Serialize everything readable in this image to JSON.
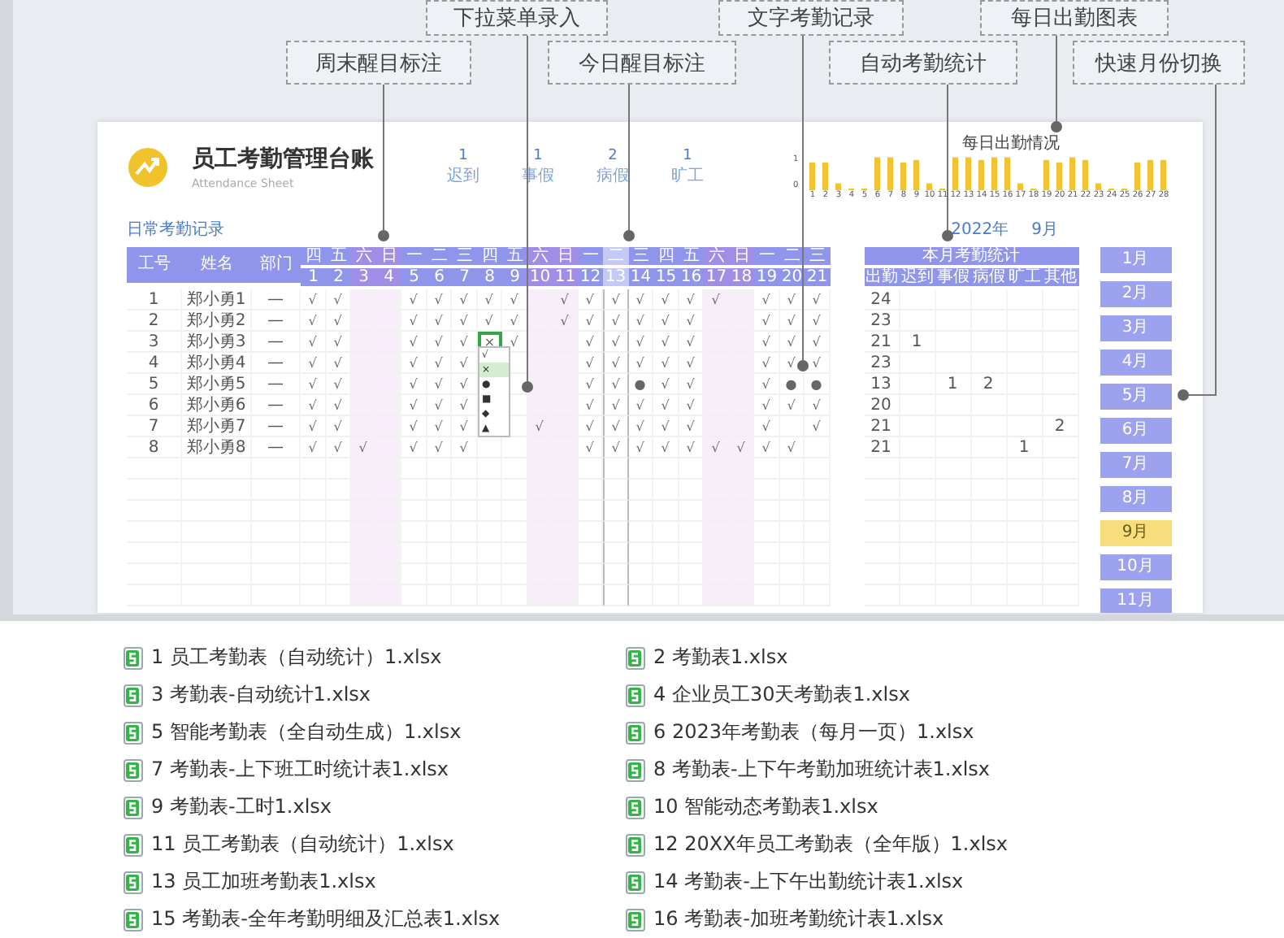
{
  "callouts": [
    {
      "label": "下拉菜单录入"
    },
    {
      "label": "文字考勤记录"
    },
    {
      "label": "每日出勤图表"
    },
    {
      "label": "周末醒目标注"
    },
    {
      "label": "今日醒目标注"
    },
    {
      "label": "自动考勤统计"
    },
    {
      "label": "快速月份切换"
    }
  ],
  "sheet": {
    "title": "员工考勤管理台账",
    "subtitle": "Attendance Sheet",
    "summary": [
      {
        "value": "1",
        "label": "迟到"
      },
      {
        "value": "1",
        "label": "事假"
      },
      {
        "value": "2",
        "label": "病假"
      },
      {
        "value": "1",
        "label": "旷工"
      }
    ],
    "chart": {
      "title": "每日出勤情况",
      "y_labels": [
        "1",
        "0"
      ],
      "days": [
        "1",
        "2",
        "3",
        "4",
        "5",
        "6",
        "7",
        "8",
        "9",
        "10",
        "11",
        "12",
        "13",
        "14",
        "15",
        "16",
        "17",
        "18",
        "19",
        "20",
        "21",
        "22",
        "23",
        "24",
        "25",
        "26",
        "27",
        "28"
      ]
    },
    "section_title": "日常考勤记录",
    "year": "2022年",
    "month": "9月",
    "columns": [
      "工号",
      "姓名",
      "部门"
    ],
    "days": [
      {
        "weekday": "四",
        "date": "1",
        "weekend": false,
        "today": false
      },
      {
        "weekday": "五",
        "date": "2",
        "weekend": false,
        "today": false
      },
      {
        "weekday": "六",
        "date": "3",
        "weekend": true,
        "today": false
      },
      {
        "weekday": "日",
        "date": "4",
        "weekend": true,
        "today": false
      },
      {
        "weekday": "一",
        "date": "5",
        "weekend": false,
        "today": false
      },
      {
        "weekday": "二",
        "date": "6",
        "weekend": false,
        "today": false
      },
      {
        "weekday": "三",
        "date": "7",
        "weekend": false,
        "today": false
      },
      {
        "weekday": "四",
        "date": "8",
        "weekend": false,
        "today": false
      },
      {
        "weekday": "五",
        "date": "9",
        "weekend": false,
        "today": false
      },
      {
        "weekday": "六",
        "date": "10",
        "weekend": true,
        "today": false
      },
      {
        "weekday": "日",
        "date": "11",
        "weekend": true,
        "today": false
      },
      {
        "weekday": "一",
        "date": "12",
        "weekend": false,
        "today": false
      },
      {
        "weekday": "二",
        "date": "13",
        "weekend": false,
        "today": true
      },
      {
        "weekday": "三",
        "date": "14",
        "weekend": false,
        "today": false
      },
      {
        "weekday": "四",
        "date": "15",
        "weekend": false,
        "today": false
      },
      {
        "weekday": "五",
        "date": "16",
        "weekend": false,
        "today": false
      },
      {
        "weekday": "六",
        "date": "17",
        "weekend": true,
        "today": false
      },
      {
        "weekday": "日",
        "date": "18",
        "weekend": true,
        "today": false
      },
      {
        "weekday": "一",
        "date": "19",
        "weekend": false,
        "today": false
      },
      {
        "weekday": "二",
        "date": "20",
        "weekend": false,
        "today": false
      },
      {
        "weekday": "三",
        "date": "21",
        "weekend": false,
        "today": false
      }
    ],
    "stats_title": "本月考勤统计",
    "stats_columns": [
      "出勤",
      "迟到",
      "事假",
      "病假",
      "旷工",
      "其他"
    ],
    "rows": [
      {
        "id": "1",
        "name": "郑小勇1",
        "dept": "—",
        "editing": false,
        "marks": [
          {
            "kind": "mark",
            "text": "√"
          },
          {
            "kind": "mark",
            "text": "√"
          },
          {
            "kind": "empty"
          },
          {
            "kind": "empty"
          },
          {
            "kind": "mark",
            "text": "√"
          },
          {
            "kind": "mark",
            "text": "√"
          },
          {
            "kind": "mark",
            "text": "√"
          },
          {
            "kind": "mark",
            "text": "√"
          },
          {
            "kind": "mark",
            "text": "√"
          },
          {
            "kind": "empty"
          },
          {
            "kind": "mark",
            "text": "√"
          },
          {
            "kind": "mark",
            "text": "√"
          },
          {
            "kind": "mark",
            "text": "√"
          },
          {
            "kind": "mark",
            "text": "√"
          },
          {
            "kind": "mark",
            "text": "√"
          },
          {
            "kind": "mark",
            "text": "√"
          },
          {
            "kind": "mark",
            "text": "√"
          },
          {
            "kind": "empty"
          },
          {
            "kind": "mark",
            "text": "√"
          },
          {
            "kind": "mark",
            "text": "√"
          },
          {
            "kind": "mark",
            "text": "√"
          }
        ],
        "stats": [
          {
            "kind": "value",
            "text": "24"
          },
          {
            "kind": "empty"
          },
          {
            "kind": "empty"
          },
          {
            "kind": "empty"
          },
          {
            "kind": "empty"
          },
          {
            "kind": "empty"
          }
        ]
      },
      {
        "id": "2",
        "name": "郑小勇2",
        "dept": "—",
        "editing": false,
        "marks": [
          {
            "kind": "mark",
            "text": "√"
          },
          {
            "kind": "mark",
            "text": "√"
          },
          {
            "kind": "empty"
          },
          {
            "kind": "empty"
          },
          {
            "kind": "mark",
            "text": "√"
          },
          {
            "kind": "mark",
            "text": "√"
          },
          {
            "kind": "mark",
            "text": "√"
          },
          {
            "kind": "mark",
            "text": "√"
          },
          {
            "kind": "mark",
            "text": "√"
          },
          {
            "kind": "empty"
          },
          {
            "kind": "mark",
            "text": "√"
          },
          {
            "kind": "mark",
            "text": "√"
          },
          {
            "kind": "mark",
            "text": "√"
          },
          {
            "kind": "mark",
            "text": "√"
          },
          {
            "kind": "mark",
            "text": "√"
          },
          {
            "kind": "mark",
            "text": "√"
          },
          {
            "kind": "empty"
          },
          {
            "kind": "empty"
          },
          {
            "kind": "mark",
            "text": "√"
          },
          {
            "kind": "mark",
            "text": "√"
          },
          {
            "kind": "mark",
            "text": "√"
          }
        ],
        "stats": [
          {
            "kind": "value",
            "text": "23"
          },
          {
            "kind": "empty"
          },
          {
            "kind": "empty"
          },
          {
            "kind": "empty"
          },
          {
            "kind": "empty"
          },
          {
            "kind": "empty"
          }
        ]
      },
      {
        "id": "3",
        "name": "郑小勇3",
        "dept": "—",
        "editing": true,
        "marks": [
          {
            "kind": "mark",
            "text": "√"
          },
          {
            "kind": "mark",
            "text": "√"
          },
          {
            "kind": "empty"
          },
          {
            "kind": "empty"
          },
          {
            "kind": "mark",
            "text": "√"
          },
          {
            "kind": "mark",
            "text": "√"
          },
          {
            "kind": "mark",
            "text": "√"
          },
          {
            "kind": "mark",
            "text": "×"
          },
          {
            "kind": "mark",
            "text": "√"
          },
          {
            "kind": "empty"
          },
          {
            "kind": "empty"
          },
          {
            "kind": "mark",
            "text": "√"
          },
          {
            "kind": "mark",
            "text": "√"
          },
          {
            "kind": "mark",
            "text": "√"
          },
          {
            "kind": "mark",
            "text": "√"
          },
          {
            "kind": "mark",
            "text": "√"
          },
          {
            "kind": "empty"
          },
          {
            "kind": "empty"
          },
          {
            "kind": "mark",
            "text": "√"
          },
          {
            "kind": "mark",
            "text": "√"
          },
          {
            "kind": "mark",
            "text": "√"
          }
        ],
        "stats": [
          {
            "kind": "value",
            "text": "21"
          },
          {
            "kind": "value",
            "text": "1"
          },
          {
            "kind": "empty"
          },
          {
            "kind": "empty"
          },
          {
            "kind": "empty"
          },
          {
            "kind": "empty"
          }
        ]
      },
      {
        "id": "4",
        "name": "郑小勇4",
        "dept": "—",
        "editing": false,
        "marks": [
          {
            "kind": "mark",
            "text": "√"
          },
          {
            "kind": "mark",
            "text": "√"
          },
          {
            "kind": "empty"
          },
          {
            "kind": "empty"
          },
          {
            "kind": "mark",
            "text": "√"
          },
          {
            "kind": "mark",
            "text": "√"
          },
          {
            "kind": "mark",
            "text": "√"
          },
          {
            "kind": "empty"
          },
          {
            "kind": "empty"
          },
          {
            "kind": "empty"
          },
          {
            "kind": "empty"
          },
          {
            "kind": "mark",
            "text": "√"
          },
          {
            "kind": "mark",
            "text": "√"
          },
          {
            "kind": "mark",
            "text": "√"
          },
          {
            "kind": "mark",
            "text": "√"
          },
          {
            "kind": "mark",
            "text": "√"
          },
          {
            "kind": "empty"
          },
          {
            "kind": "empty"
          },
          {
            "kind": "mark",
            "text": "√"
          },
          {
            "kind": "mark",
            "text": "√"
          },
          {
            "kind": "mark",
            "text": "√"
          }
        ],
        "stats": [
          {
            "kind": "value",
            "text": "23"
          },
          {
            "kind": "empty"
          },
          {
            "kind": "empty"
          },
          {
            "kind": "empty"
          },
          {
            "kind": "empty"
          },
          {
            "kind": "empty"
          }
        ]
      },
      {
        "id": "5",
        "name": "郑小勇5",
        "dept": "—",
        "editing": false,
        "marks": [
          {
            "kind": "mark",
            "text": "√"
          },
          {
            "kind": "mark",
            "text": "√"
          },
          {
            "kind": "empty"
          },
          {
            "kind": "empty"
          },
          {
            "kind": "mark",
            "text": "√"
          },
          {
            "kind": "mark",
            "text": "√"
          },
          {
            "kind": "mark",
            "text": "√"
          },
          {
            "kind": "empty"
          },
          {
            "kind": "empty"
          },
          {
            "kind": "empty"
          },
          {
            "kind": "empty"
          },
          {
            "kind": "mark",
            "text": "√"
          },
          {
            "kind": "mark",
            "text": "√"
          },
          {
            "kind": "mark",
            "text": "●"
          },
          {
            "kind": "mark",
            "text": "√"
          },
          {
            "kind": "mark",
            "text": "√"
          },
          {
            "kind": "empty"
          },
          {
            "kind": "empty"
          },
          {
            "kind": "mark",
            "text": "√"
          },
          {
            "kind": "mark",
            "text": "●"
          },
          {
            "kind": "mark",
            "text": "●"
          }
        ],
        "stats": [
          {
            "kind": "value",
            "text": "13"
          },
          {
            "kind": "empty"
          },
          {
            "kind": "value",
            "text": "1"
          },
          {
            "kind": "value",
            "text": "2"
          },
          {
            "kind": "empty"
          },
          {
            "kind": "empty"
          }
        ]
      },
      {
        "id": "6",
        "name": "郑小勇6",
        "dept": "—",
        "editing": false,
        "marks": [
          {
            "kind": "mark",
            "text": "√"
          },
          {
            "kind": "mark",
            "text": "√"
          },
          {
            "kind": "empty"
          },
          {
            "kind": "empty"
          },
          {
            "kind": "mark",
            "text": "√"
          },
          {
            "kind": "mark",
            "text": "√"
          },
          {
            "kind": "mark",
            "text": "√"
          },
          {
            "kind": "empty"
          },
          {
            "kind": "empty"
          },
          {
            "kind": "empty"
          },
          {
            "kind": "empty"
          },
          {
            "kind": "mark",
            "text": "√"
          },
          {
            "kind": "mark",
            "text": "√"
          },
          {
            "kind": "mark",
            "text": "√"
          },
          {
            "kind": "mark",
            "text": "√"
          },
          {
            "kind": "mark",
            "text": "√"
          },
          {
            "kind": "empty"
          },
          {
            "kind": "empty"
          },
          {
            "kind": "mark",
            "text": "√"
          },
          {
            "kind": "mark",
            "text": "√"
          },
          {
            "kind": "mark",
            "text": "√"
          }
        ],
        "stats": [
          {
            "kind": "value",
            "text": "20"
          },
          {
            "kind": "empty"
          },
          {
            "kind": "empty"
          },
          {
            "kind": "empty"
          },
          {
            "kind": "empty"
          },
          {
            "kind": "empty"
          }
        ]
      },
      {
        "id": "7",
        "name": "郑小勇7",
        "dept": "—",
        "editing": false,
        "marks": [
          {
            "kind": "mark",
            "text": "√"
          },
          {
            "kind": "mark",
            "text": "√"
          },
          {
            "kind": "empty"
          },
          {
            "kind": "empty"
          },
          {
            "kind": "mark",
            "text": "√"
          },
          {
            "kind": "mark",
            "text": "√"
          },
          {
            "kind": "mark",
            "text": "√"
          },
          {
            "kind": "empty"
          },
          {
            "kind": "empty"
          },
          {
            "kind": "mark",
            "text": "√"
          },
          {
            "kind": "empty"
          },
          {
            "kind": "mark",
            "text": "√"
          },
          {
            "kind": "mark",
            "text": "√"
          },
          {
            "kind": "mark",
            "text": "√"
          },
          {
            "kind": "mark",
            "text": "√"
          },
          {
            "kind": "mark",
            "text": "√"
          },
          {
            "kind": "empty"
          },
          {
            "kind": "empty"
          },
          {
            "kind": "mark",
            "text": "√"
          },
          {
            "kind": "empty"
          },
          {
            "kind": "mark",
            "text": "√"
          }
        ],
        "stats": [
          {
            "kind": "value",
            "text": "21"
          },
          {
            "kind": "empty"
          },
          {
            "kind": "empty"
          },
          {
            "kind": "empty"
          },
          {
            "kind": "empty"
          },
          {
            "kind": "value",
            "text": "2"
          }
        ]
      },
      {
        "id": "8",
        "name": "郑小勇8",
        "dept": "—",
        "editing": false,
        "marks": [
          {
            "kind": "mark",
            "text": "√"
          },
          {
            "kind": "mark",
            "text": "√"
          },
          {
            "kind": "mark",
            "text": "√"
          },
          {
            "kind": "empty"
          },
          {
            "kind": "mark",
            "text": "√"
          },
          {
            "kind": "mark",
            "text": "√"
          },
          {
            "kind": "mark",
            "text": "√"
          },
          {
            "kind": "empty"
          },
          {
            "kind": "empty"
          },
          {
            "kind": "empty"
          },
          {
            "kind": "empty"
          },
          {
            "kind": "mark",
            "text": "√"
          },
          {
            "kind": "mark",
            "text": "√"
          },
          {
            "kind": "mark",
            "text": "√"
          },
          {
            "kind": "mark",
            "text": "√"
          },
          {
            "kind": "mark",
            "text": "√"
          },
          {
            "kind": "mark",
            "text": "√"
          },
          {
            "kind": "mark",
            "text": "√"
          },
          {
            "kind": "mark",
            "text": "√"
          },
          {
            "kind": "mark",
            "text": "√"
          },
          {
            "kind": "empty"
          }
        ],
        "stats": [
          {
            "kind": "value",
            "text": "21"
          },
          {
            "kind": "empty"
          },
          {
            "kind": "empty"
          },
          {
            "kind": "empty"
          },
          {
            "kind": "value",
            "text": "1"
          },
          {
            "kind": "empty"
          }
        ]
      }
    ],
    "dropdown": {
      "options": [
        {
          "label": "√",
          "selected": false
        },
        {
          "label": "×",
          "selected": true
        },
        {
          "label": "●",
          "selected": false
        },
        {
          "label": "■",
          "selected": false
        },
        {
          "label": "◆",
          "selected": false
        },
        {
          "label": "▲",
          "selected": false
        }
      ]
    },
    "months": [
      {
        "label": "1月",
        "selected": false
      },
      {
        "label": "2月",
        "selected": false
      },
      {
        "label": "3月",
        "selected": false
      },
      {
        "label": "4月",
        "selected": false
      },
      {
        "label": "5月",
        "selected": false
      },
      {
        "label": "6月",
        "selected": false
      },
      {
        "label": "7月",
        "selected": false
      },
      {
        "label": "8月",
        "selected": false
      },
      {
        "label": "9月",
        "selected": true
      },
      {
        "label": "10月",
        "selected": false
      },
      {
        "label": "11月",
        "selected": false
      }
    ]
  },
  "files": [
    "1 员工考勤表（自动统计）1.xlsx",
    "2 考勤表1.xlsx",
    "3 考勤表-自动统计1.xlsx",
    "4 企业员工30天考勤表1.xlsx",
    "5 智能考勤表（全自动生成）1.xlsx",
    "6 2023年考勤表（每月一页）1.xlsx",
    "7 考勤表-上下班工时统计表1.xlsx",
    "8 考勤表-上下午考勤加班统计表1.xlsx",
    "9 考勤表-工时1.xlsx",
    "10 智能动态考勤表1.xlsx",
    "11 员工考勤表（自动统计）1.xlsx",
    "12 20XX年员工考勤表（全年版）1.xlsx",
    "13 员工加班考勤表1.xlsx",
    "14 考勤表-上下午出勤统计表1.xlsx",
    "15 考勤表-全年考勤明细及汇总表1.xlsx",
    "16 考勤表-加班考勤统计表1.xlsx"
  ]
}
